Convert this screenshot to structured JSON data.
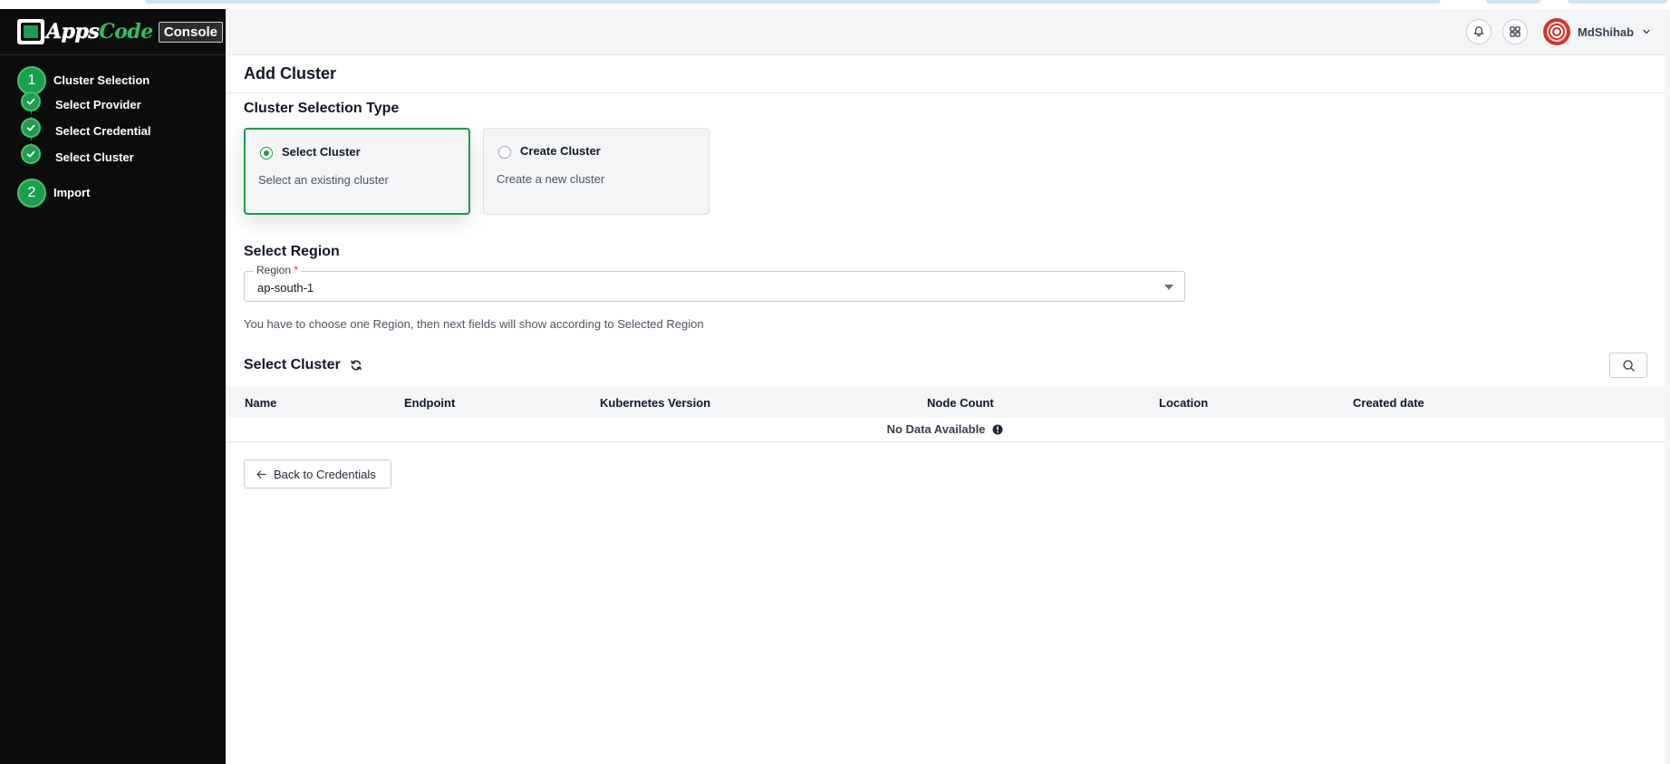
{
  "brand": {
    "logo_text_a": "Apps",
    "logo_text_b": "Code",
    "console_label": "Console"
  },
  "sidebar": {
    "steps": [
      {
        "number": "1",
        "label": "Cluster Selection"
      },
      {
        "number": "2",
        "label": "Import"
      }
    ],
    "substeps": [
      {
        "label": "Select Provider",
        "done": true
      },
      {
        "label": "Select Credential",
        "done": true
      },
      {
        "label": "Select Cluster",
        "done": true
      }
    ]
  },
  "header": {
    "notification_icon": "bell-icon",
    "apps_icon": "grid-icon",
    "user_name": "MdShihab"
  },
  "page": {
    "title": "Add Cluster"
  },
  "selection_type": {
    "title": "Cluster Selection Type",
    "options": [
      {
        "title": "Select Cluster",
        "description": "Select an existing cluster",
        "selected": true
      },
      {
        "title": "Create Cluster",
        "description": "Create a new cluster",
        "selected": false
      }
    ]
  },
  "region": {
    "section_title": "Select Region",
    "label": "Region",
    "required_mark": "*",
    "value": "ap-south-1",
    "help": "You have to choose one Region, then next fields will show according to Selected Region"
  },
  "cluster_table": {
    "title": "Select Cluster",
    "columns": [
      "Name",
      "Endpoint",
      "Kubernetes Version",
      "Node Count",
      "Location",
      "Created date"
    ],
    "rows": [],
    "empty_text": "No Data Available"
  },
  "back_button": {
    "label": "Back to Credentials"
  },
  "colors": {
    "accent": "#1a9e4b",
    "sidebar_bg": "#0b0d0c",
    "header_bg": "#f4f5f7"
  }
}
